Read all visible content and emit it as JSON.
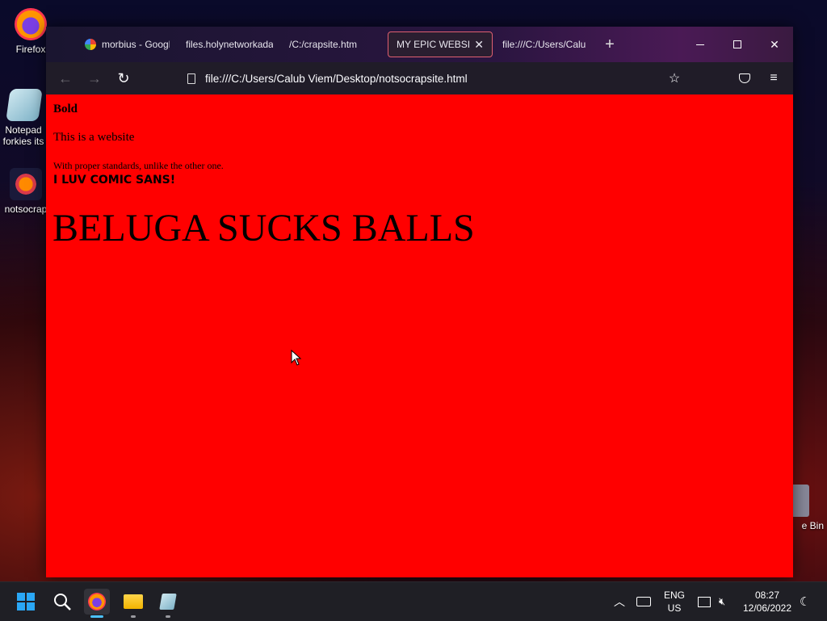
{
  "desktop": {
    "icons": [
      {
        "label": "Firefox"
      },
      {
        "label": "Notepad forkies its"
      },
      {
        "label": "notsocrap"
      },
      {
        "label": "e Bin"
      }
    ]
  },
  "browser": {
    "tabs": [
      {
        "label": "morbius - Googl"
      },
      {
        "label": "files.holynetworkada"
      },
      {
        "label": "/C:/crapsite.htm"
      },
      {
        "label": "MY EPIC WEBSIGH"
      },
      {
        "label": "file:///C:/Users/Calu"
      }
    ],
    "new_tab": "+",
    "close_tab": "✕",
    "url": "file:///C:/Users/Calub Viem/Desktop/notsocrapsite.html",
    "controls": {
      "minimize": "—",
      "maximize": "☐",
      "close": "✕"
    }
  },
  "page": {
    "bold": "Bold",
    "line1": "This is a website",
    "line2": "With proper standards, unlike the other one.",
    "comic": "I LUV COMIC SANS!",
    "heading": "BELUGA SUCKS BALLS",
    "background": "#ff0000"
  },
  "taskbar": {
    "lang_top": "ENG",
    "lang_bottom": "US",
    "time": "08:27",
    "date": "12/06/2022"
  }
}
